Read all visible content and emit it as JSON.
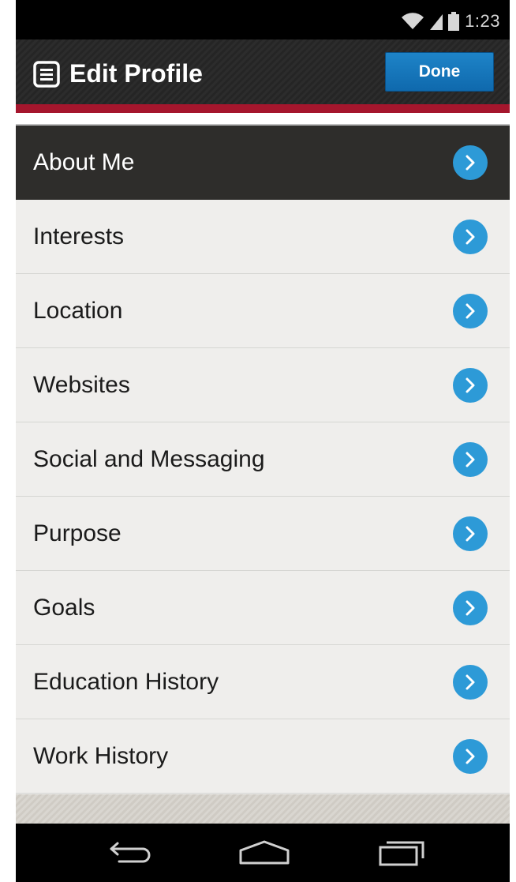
{
  "status_bar": {
    "time": "1:23",
    "icons": [
      "wifi-icon",
      "signal-icon",
      "battery-icon"
    ]
  },
  "header": {
    "title": "Edit Profile",
    "title_icon": "document-icon",
    "done_label": "Done"
  },
  "menu": {
    "items": [
      {
        "label": "About Me",
        "active": true
      },
      {
        "label": "Interests"
      },
      {
        "label": "Location"
      },
      {
        "label": "Websites"
      },
      {
        "label": "Social and Messaging"
      },
      {
        "label": "Purpose"
      },
      {
        "label": "Goals"
      },
      {
        "label": "Education History"
      },
      {
        "label": "Work History"
      }
    ]
  },
  "nav_bar": {
    "buttons": [
      "back-icon",
      "home-icon",
      "recent-apps-icon"
    ]
  },
  "colors": {
    "accent_blue": "#2d9ad7",
    "done_button": "#1677bd",
    "header_red": "#a5162d",
    "active_row": "#2e2d2b"
  }
}
